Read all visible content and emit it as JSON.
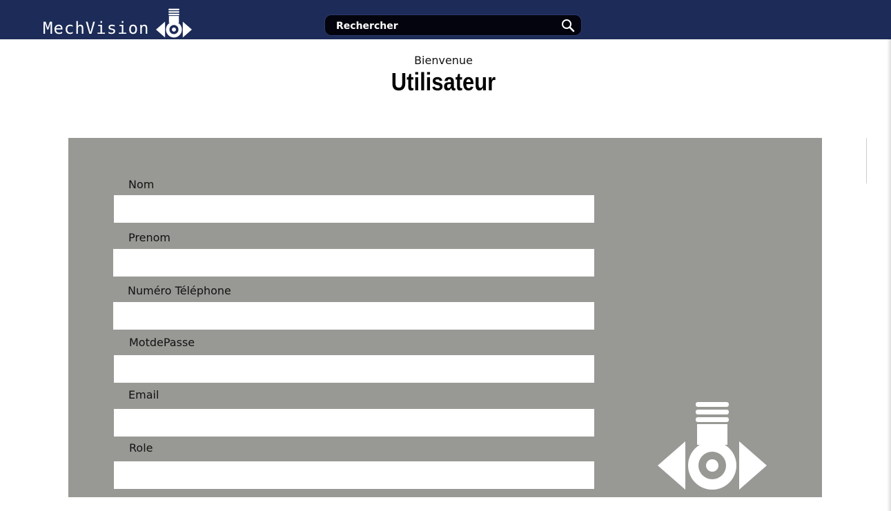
{
  "header": {
    "brand": "MechVision",
    "search": {
      "placeholder": "Rechercher"
    }
  },
  "welcome": {
    "greeting": "Bienvenue",
    "title": "Utilisateur"
  },
  "form": {
    "fields": [
      {
        "label": "Nom",
        "value": ""
      },
      {
        "label": "Prenom",
        "value": ""
      },
      {
        "label": "Numéro Téléphone",
        "value": ""
      },
      {
        "label": "MotdePasse",
        "value": ""
      },
      {
        "label": "Email",
        "value": ""
      },
      {
        "label": "Role",
        "value": ""
      }
    ]
  },
  "colors": {
    "header_bg": "#1c2b57",
    "panel_bg": "#989895",
    "search_bg": "#03040d"
  },
  "icons": {
    "brand": "mechvision-logo-icon",
    "search": "search-icon",
    "panel_logo": "mechvision-logo-icon"
  }
}
